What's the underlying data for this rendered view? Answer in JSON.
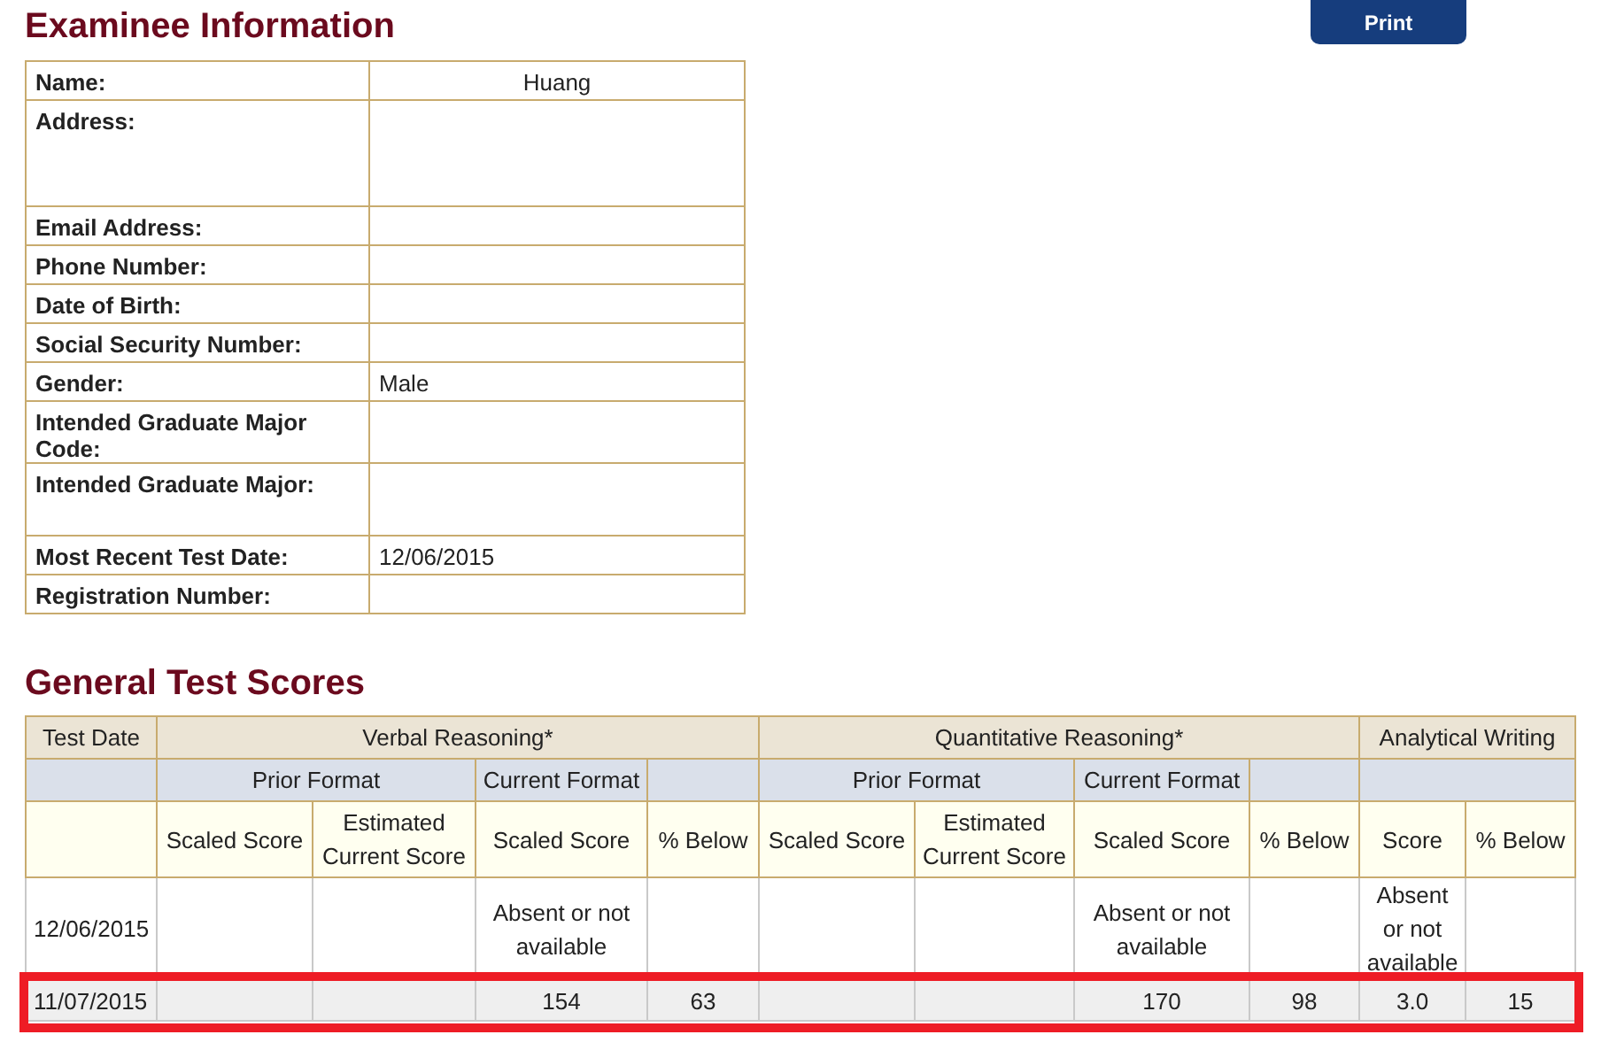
{
  "print_button": "Print",
  "examinee": {
    "title": "Examinee Information",
    "rows": [
      {
        "label": "Name:",
        "value": "Huang",
        "kind": "centered"
      },
      {
        "label": "Address:",
        "kind": "tall"
      },
      {
        "label": "Email Address:",
        "kind": "short"
      },
      {
        "label": "Phone Number:",
        "kind": "short"
      },
      {
        "label": "Date of Birth:",
        "kind": "short"
      },
      {
        "label": "Social Security Number:",
        "kind": "short"
      },
      {
        "label": "Gender:",
        "value": "Male",
        "kind": "short"
      },
      {
        "label": "Intended Graduate Major Code:",
        "kind": "short"
      },
      {
        "label": "Intended Graduate Major:",
        "kind": "medium"
      },
      {
        "label": "Most Recent Test Date:",
        "value": "12/06/2015",
        "kind": "short"
      },
      {
        "label": "Registration Number:",
        "kind": "short"
      }
    ]
  },
  "scores": {
    "title": "General Test Scores",
    "first_column": "Test Date",
    "sections": [
      {
        "title": "Verbal Reasoning*",
        "formats": [
          {
            "label": "Prior Format",
            "columns": [
              "Scaled Score",
              "Estimated Current Score"
            ]
          },
          {
            "label": "Current Format",
            "columns": [
              "Scaled Score"
            ]
          },
          {
            "columns": [
              "% Below"
            ]
          }
        ]
      },
      {
        "title": "Quantitative Reasoning*",
        "formats": [
          {
            "label": "Prior Format",
            "columns": [
              "Scaled Score",
              "Estimated Current Score"
            ]
          },
          {
            "label": "Current Format",
            "columns": [
              "Scaled Score"
            ]
          },
          {
            "columns": [
              "% Below"
            ]
          }
        ]
      },
      {
        "title": "Analytical Writing",
        "formats": [
          {
            "columns": [
              "Score",
              "% Below"
            ]
          }
        ]
      }
    ],
    "rows": [
      {
        "date": "12/06/2015",
        "cells": [
          null,
          null,
          "Absent or not available",
          null,
          null,
          null,
          "Absent or not available",
          null,
          "Absent or not available",
          null
        ],
        "highlighted": false
      },
      {
        "date": "11/07/2015",
        "cells": [
          null,
          null,
          "154",
          "63",
          null,
          null,
          "170",
          "98",
          "3.0",
          "15"
        ],
        "highlighted": true
      }
    ]
  }
}
